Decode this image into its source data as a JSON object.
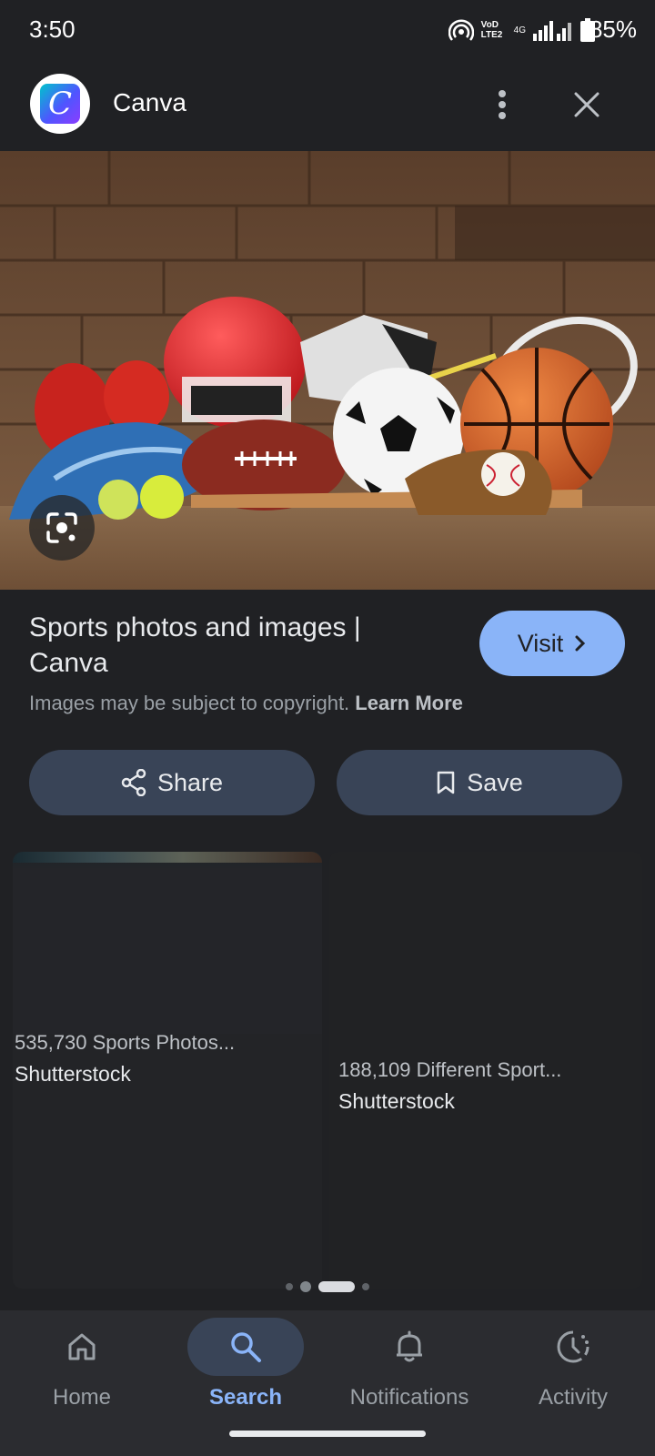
{
  "status_bar": {
    "time": "3:50",
    "network_label": "VoD LTE2",
    "signal_label": "4G",
    "battery": "85%"
  },
  "header": {
    "logo_letter": "C",
    "title": "Canva",
    "more_icon": "more-vert-icon",
    "close_icon": "close-icon"
  },
  "result": {
    "title": "Sports photos and images | Canva",
    "visit_label": "Visit",
    "copyright_text": "Images may be subject to copyright.",
    "learn_more": "Learn More",
    "share_label": "Share",
    "save_label": "Save"
  },
  "related": [
    {
      "title": "535,730 Sports Photos...",
      "source": "Shutterstock"
    },
    {
      "title": "188,109 Different Sport...",
      "source": "Shutterstock"
    }
  ],
  "carousel": {
    "page_count": 4,
    "active_index": 2
  },
  "bottom_nav": [
    {
      "label": "Home",
      "icon": "home-icon",
      "active": false
    },
    {
      "label": "Search",
      "icon": "search-icon",
      "active": true
    },
    {
      "label": "Notifications",
      "icon": "bell-icon",
      "active": false
    },
    {
      "label": "Activity",
      "icon": "activity-icon",
      "active": false
    }
  ],
  "colors": {
    "background": "#202124",
    "accent": "#8ab4f8",
    "button_bg": "#394457"
  }
}
